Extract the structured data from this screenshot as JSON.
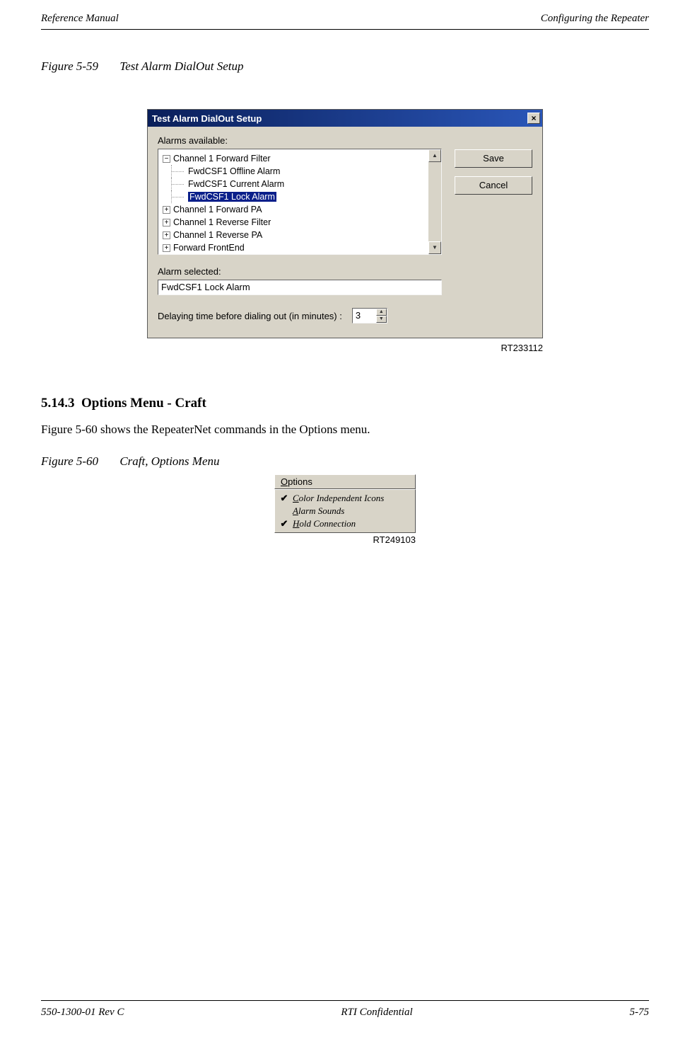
{
  "header": {
    "left": "Reference Manual",
    "right": "Configuring the Repeater"
  },
  "fig1": {
    "num": "Figure 5-59",
    "title": "Test Alarm DialOut Setup",
    "code": "RT233112"
  },
  "dialog": {
    "title": "Test Alarm DialOut Setup",
    "close": "×",
    "alarms_label": "Alarms available:",
    "tree": {
      "parent": "Channel 1 Forward Filter",
      "child1": "FwdCSF1 Offline Alarm",
      "child2": "FwdCSF1 Current Alarm",
      "child3_selected": "FwdCSF1 Lock Alarm",
      "p2": "Channel 1 Forward PA",
      "p3": "Channel 1 Reverse Filter",
      "p4": "Channel 1 Reverse PA",
      "p5": "Forward FrontEnd"
    },
    "selected_label": "Alarm selected:",
    "selected_value": "FwdCSF1 Lock Alarm",
    "delay_label": "Delaying time before dialing out (in minutes) :",
    "delay_value": "3",
    "save": "Save",
    "cancel": "Cancel",
    "scroll_up": "▲",
    "scroll_down": "▼"
  },
  "section": {
    "num": "5.14.3",
    "title": "Options Menu - Craft",
    "body": "Figure 5-60 shows the RepeaterNet commands in the Options menu."
  },
  "fig2": {
    "num": "Figure 5-60",
    "title": "Craft, Options Menu",
    "code": "RT249103"
  },
  "menu": {
    "head_u": "O",
    "head_rest": "ptions",
    "i1_check": "✔",
    "i1_u": "C",
    "i1_rest": "olor Independent Icons",
    "i2_check": "",
    "i2_u": "A",
    "i2_rest": "larm Sounds",
    "i3_check": "✔",
    "i3_u": "H",
    "i3_rest": "old Connection"
  },
  "footer": {
    "left": "550-1300-01 Rev C",
    "center": "RTI Confidential",
    "right": "5-75"
  }
}
